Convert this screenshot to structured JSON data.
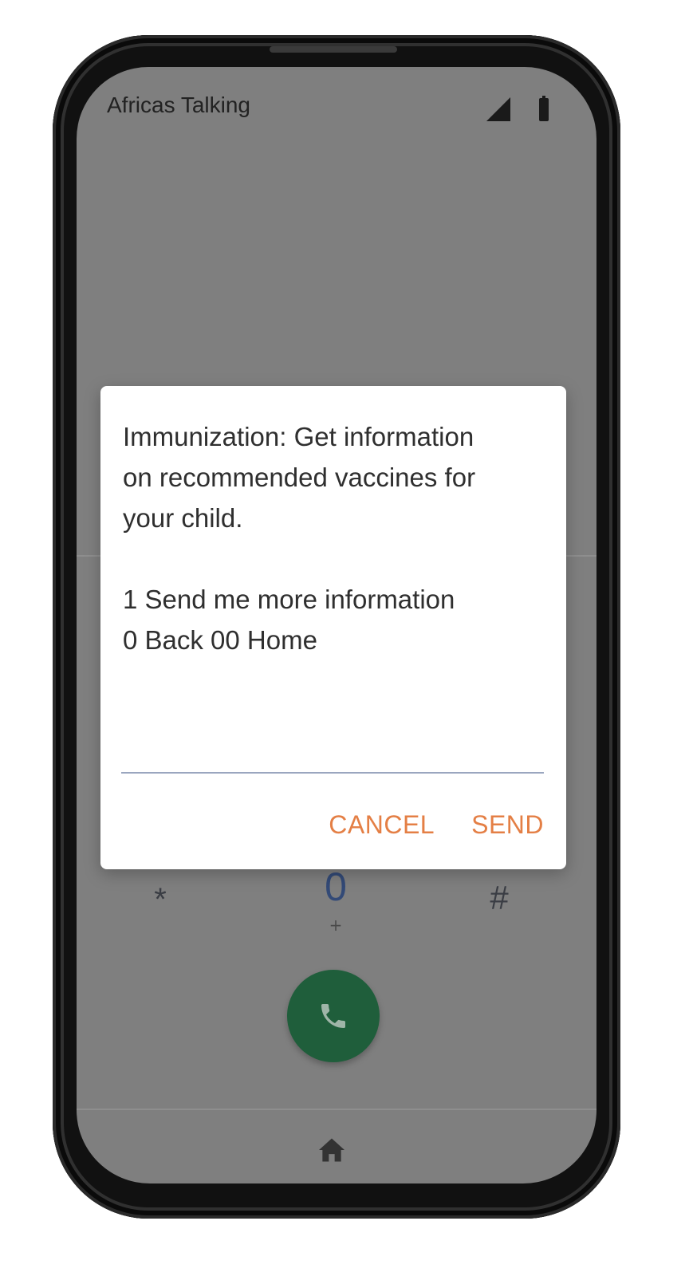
{
  "status_bar": {
    "carrier": "Africas Talking",
    "signal_icon": "signal-icon",
    "battery_icon": "battery-icon"
  },
  "dialog": {
    "message": "Immunization: Get information\non recommended vaccines for\nyour child.\n\n1 Send me more information\n0 Back 00 Home",
    "input_value": "",
    "cancel_label": "CANCEL",
    "send_label": "SEND"
  },
  "keypad": {
    "star": "*",
    "zero": "0",
    "zero_sub": "+",
    "hash": "#"
  },
  "call_button": {
    "icon": "phone-icon"
  },
  "nav": {
    "home_icon": "home-icon"
  },
  "colors": {
    "screen_overlay": "#7f7f7f",
    "accent": "#e47f45",
    "call_green": "#1f5e3b",
    "phone_body": "#111111"
  }
}
